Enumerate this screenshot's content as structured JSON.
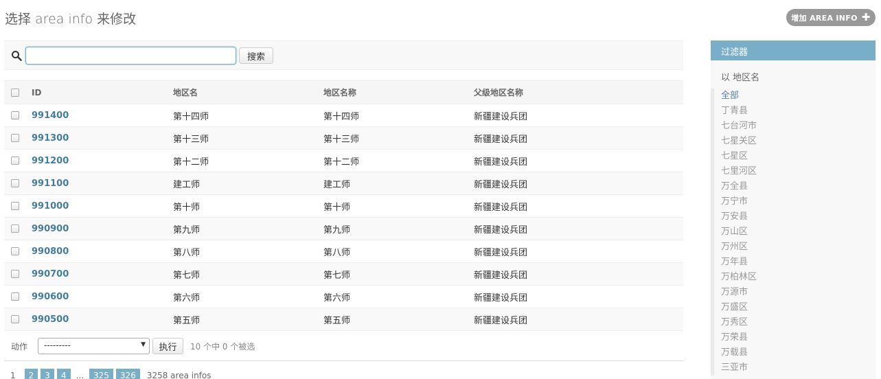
{
  "header": {
    "title": "选择 area info 来修改",
    "add_button": "增加 AREA INFO"
  },
  "search": {
    "value": "",
    "placeholder": "",
    "button": "搜索"
  },
  "table": {
    "columns": [
      "ID",
      "地区名",
      "地区名称",
      "父级地区名称"
    ],
    "rows": [
      {
        "id": "991400",
        "name": "第十四师",
        "full": "第十四师",
        "parent": "新疆建设兵团"
      },
      {
        "id": "991300",
        "name": "第十三师",
        "full": "第十三师",
        "parent": "新疆建设兵团"
      },
      {
        "id": "991200",
        "name": "第十二师",
        "full": "第十二师",
        "parent": "新疆建设兵团"
      },
      {
        "id": "991100",
        "name": "建工师",
        "full": "建工师",
        "parent": "新疆建设兵团"
      },
      {
        "id": "991000",
        "name": "第十师",
        "full": "第十师",
        "parent": "新疆建设兵团"
      },
      {
        "id": "990900",
        "name": "第九师",
        "full": "第九师",
        "parent": "新疆建设兵团"
      },
      {
        "id": "990800",
        "name": "第八师",
        "full": "第八师",
        "parent": "新疆建设兵团"
      },
      {
        "id": "990700",
        "name": "第七师",
        "full": "第七师",
        "parent": "新疆建设兵团"
      },
      {
        "id": "990600",
        "name": "第六师",
        "full": "第六师",
        "parent": "新疆建设兵团"
      },
      {
        "id": "990500",
        "name": "第五师",
        "full": "第五师",
        "parent": "新疆建设兵团"
      }
    ]
  },
  "actions": {
    "label": "动作",
    "select_value": "---------",
    "run_button": "执行",
    "selected_count": "10 个中 0 个被选"
  },
  "pagination": {
    "current": "1",
    "pages": [
      "2",
      "3",
      "4"
    ],
    "ellipsis": "...",
    "last_pages": [
      "325",
      "326"
    ],
    "total": "3258 area infos"
  },
  "filter": {
    "title": "过滤器",
    "subtitle": "以 地区名",
    "items": [
      "全部",
      "丁青县",
      "七台河市",
      "七星关区",
      "七星区",
      "七里河区",
      "万全县",
      "万宁市",
      "万安县",
      "万山区",
      "万州区",
      "万年县",
      "万柏林区",
      "万源市",
      "万盛区",
      "万秀区",
      "万荣县",
      "万载县",
      "三亚市"
    ]
  },
  "colors": {
    "accent": "#79aec8",
    "link": "#447e9b"
  }
}
